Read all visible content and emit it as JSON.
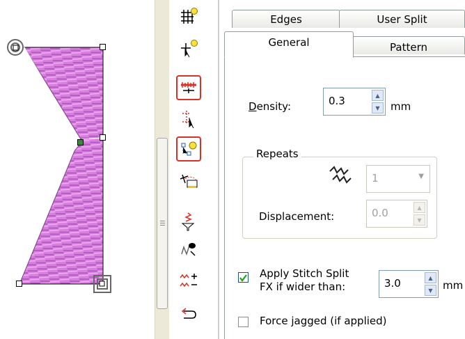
{
  "canvas": {
    "fill_color": "#d97fe0"
  },
  "toolbar": {
    "tools": [
      {
        "name": "grid-bulb-icon",
        "active": false
      },
      {
        "name": "select-point-bulb-icon",
        "active": false
      },
      {
        "name": "measure-icon",
        "active": true
      },
      {
        "name": "reshape-icon",
        "active": false
      },
      {
        "name": "split-points-bulb-icon",
        "active": true
      },
      {
        "name": "angle-tool-icon",
        "active": false
      },
      {
        "name": "stitch-funnel-icon",
        "active": false
      },
      {
        "name": "trace-icon",
        "active": false
      },
      {
        "name": "stitch-plus-minus-icon",
        "active": false
      },
      {
        "name": "return-arrow-icon",
        "active": false
      }
    ]
  },
  "tabs": {
    "edges": "Edges",
    "user_split": "User Split",
    "general": "General",
    "pattern": "Pattern",
    "active": "General"
  },
  "general": {
    "density_label": "Density:",
    "density_value": "0.3",
    "density_unit": "mm",
    "repeats_title": "Repeats",
    "repeats_value": "1",
    "displacement_label": "Displacement:",
    "displacement_value": "0.0",
    "apply_split_label_1": "Apply Stitch Split",
    "apply_split_label_2": "FX if wider than:",
    "apply_split_checked": true,
    "apply_split_value": "3.0",
    "apply_split_unit": "mm",
    "force_jagged_label": "Force jagged (if applied)",
    "force_jagged_checked": false
  }
}
